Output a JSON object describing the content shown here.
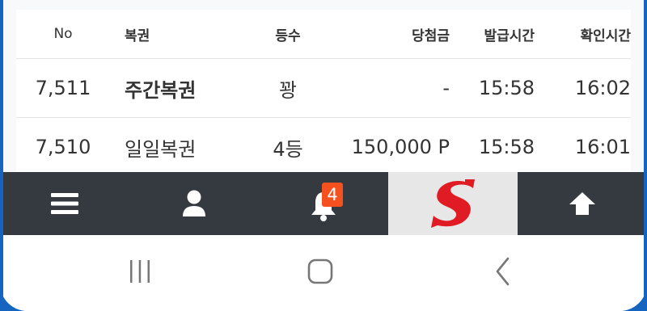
{
  "table": {
    "headers": [
      "No",
      "복권",
      "등수",
      "당첨금",
      "발급시간",
      "확인시간"
    ],
    "rows": [
      {
        "no": "7,511",
        "lottery": "주간복권",
        "rank": "꽝",
        "prize": "-",
        "issued": "15:58",
        "checked": "16:02"
      },
      {
        "no": "7,510",
        "lottery": "일일복권",
        "rank": "4등",
        "prize": "150,000 P",
        "issued": "15:58",
        "checked": "16:01"
      }
    ]
  },
  "tabbar": {
    "items": [
      {
        "name": "menu",
        "icon": "menu-icon"
      },
      {
        "name": "profile",
        "icon": "user-icon"
      },
      {
        "name": "notifications",
        "icon": "bell-icon",
        "badge": "4"
      },
      {
        "name": "home-logo",
        "icon": "s-logo"
      },
      {
        "name": "scroll-top",
        "icon": "arrow-up-icon"
      }
    ]
  },
  "navbar": {
    "items": [
      "recent-apps-icon",
      "home-icon",
      "back-icon"
    ]
  },
  "colors": {
    "tabbar_bg": "#343a40",
    "badge": "#f4511e",
    "logo_red": "#e01b24",
    "frame": "#1565c0"
  }
}
